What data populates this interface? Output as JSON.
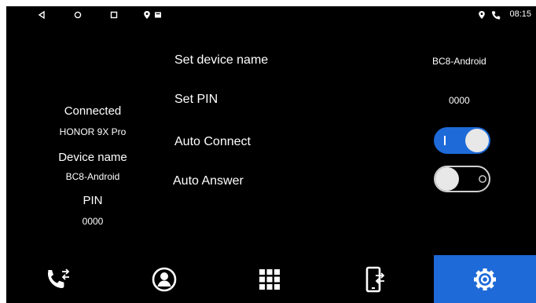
{
  "status_bar": {
    "time": "08:15"
  },
  "summary": {
    "connected_label": "Connected",
    "connected_value": "HONOR 9X Pro",
    "device_name_label": "Device name",
    "device_name_value": "BC8-Android",
    "pin_label": "PIN",
    "pin_value": "0000"
  },
  "settings": {
    "device_name_label": "Set device name",
    "device_name_value": "BC8-Android",
    "pin_label": "Set PIN",
    "pin_value": "0000",
    "auto_connect_label": "Auto Connect",
    "auto_connect_on": true,
    "auto_answer_label": "Auto Answer",
    "auto_answer_on": false
  },
  "nav": {
    "items": [
      "call-transfer-icon",
      "contacts-icon",
      "dialpad-icon",
      "phone-transfer-icon",
      "settings-icon"
    ],
    "active": "settings-icon"
  },
  "colors": {
    "accent": "#1e6ad8",
    "background": "#000000"
  }
}
